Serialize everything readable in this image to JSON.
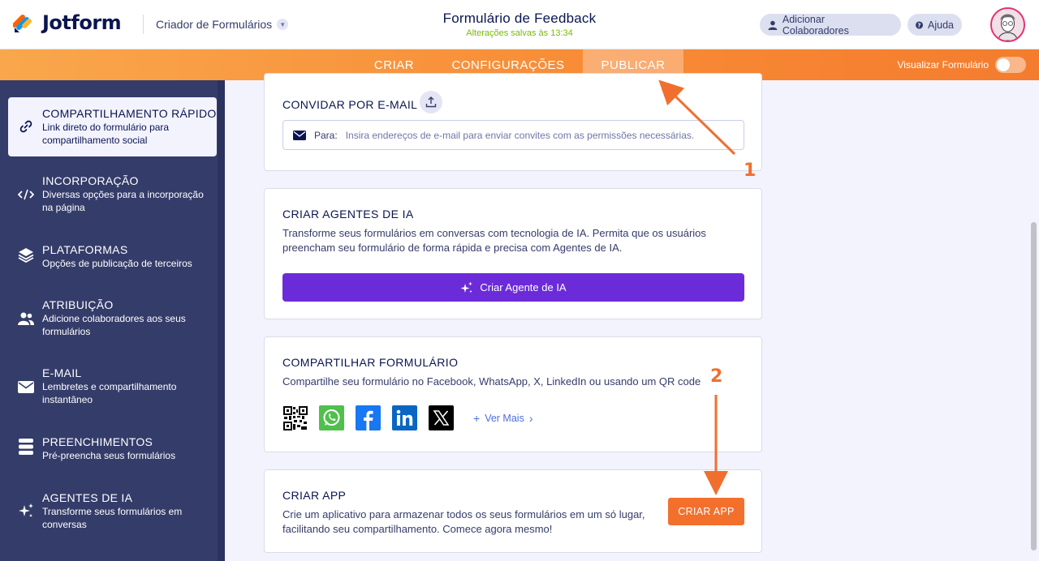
{
  "header": {
    "logo_text": "Jotform",
    "builder_name": "Criador de Formulários",
    "form_title": "Formulário de Feedback",
    "save_status": "Alterações salvas às 13:34",
    "collab_label": "Adicionar Colaboradores",
    "help_label": "Ajuda"
  },
  "nav": {
    "tabs": [
      {
        "label": "CRIAR"
      },
      {
        "label": "CONFIGURAÇÕES"
      },
      {
        "label": "PUBLICAR"
      }
    ],
    "active_tab": "PUBLICAR",
    "preview_label": "Visualizar Formulário"
  },
  "sidebar": {
    "items": [
      {
        "title": "COMPARTILHAMENTO RÁPIDO",
        "desc": "Link direto do formulário para compartilhamento social",
        "icon": "link-icon"
      },
      {
        "title": "INCORPORAÇÃO",
        "desc": "Diversas opções para a incorporação na página",
        "icon": "code-icon"
      },
      {
        "title": "PLATAFORMAS",
        "desc": "Opções de publicação de terceiros",
        "icon": "layers-icon"
      },
      {
        "title": "ATRIBUIÇÃO",
        "desc": "Adicione colaboradores aos seus formulários",
        "icon": "users-icon"
      },
      {
        "title": "E-MAIL",
        "desc": "Lembretes e compartilhamento instantâneo",
        "icon": "envelope-icon"
      },
      {
        "title": "PREENCHIMENTOS",
        "desc": "Pré-preencha seus formulários",
        "icon": "stack-icon"
      },
      {
        "title": "AGENTES DE IA",
        "desc": "Transforme seus formulários em conversas",
        "icon": "sparkle-icon"
      }
    ]
  },
  "invite": {
    "title": "CONVIDAR POR E-MAIL",
    "to_label": "Para:",
    "placeholder": "Insira endereços de e-mail para enviar convites com as permissões necessárias."
  },
  "ai_agents": {
    "title": "CRIAR AGENTES DE IA",
    "text": "Transforme seus formulários em conversas com tecnologia de IA. Permita que os usuários preencham seu formulário de forma rápida e precisa com Agentes de IA.",
    "button": "Criar Agente de IA"
  },
  "share": {
    "title": "COMPARTILHAR FORMULÁRIO",
    "text": "Compartilhe seu formulário no Facebook, WhatsApp, X, LinkedIn ou usando um QR code",
    "see_more": "Ver Mais"
  },
  "app": {
    "title": "CRIAR APP",
    "text": "Crie um aplicativo para armazenar todos os seus formulários em um só lugar, facilitando seu compartilhamento. Comece agora mesmo!",
    "button": "CRIAR APP"
  },
  "annotations": {
    "one": "1",
    "two": "2"
  },
  "colors": {
    "accent_orange": "#f3702c",
    "ai_purple": "#6c2bd9",
    "sidebar_bg": "#343c6a"
  }
}
